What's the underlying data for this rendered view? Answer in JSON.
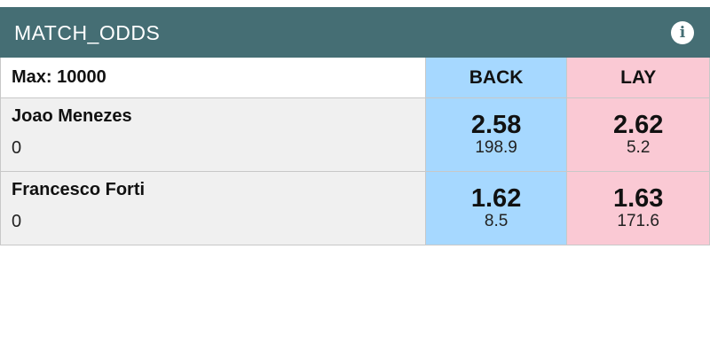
{
  "market": {
    "title": "MATCH_ODDS",
    "info_icon": "info-icon",
    "max_label": "Max: 10000",
    "back_label": "BACK",
    "lay_label": "LAY",
    "colors": {
      "header_bg": "#456e74",
      "back_bg": "#a6d8ff",
      "lay_bg": "#fac9d4"
    }
  },
  "runners": [
    {
      "name": "Joao Menezes",
      "position": "0",
      "back": {
        "price": "2.58",
        "size": "198.9"
      },
      "lay": {
        "price": "2.62",
        "size": "5.2"
      }
    },
    {
      "name": "Francesco Forti",
      "position": "0",
      "back": {
        "price": "1.62",
        "size": "8.5"
      },
      "lay": {
        "price": "1.63",
        "size": "171.6"
      }
    }
  ]
}
